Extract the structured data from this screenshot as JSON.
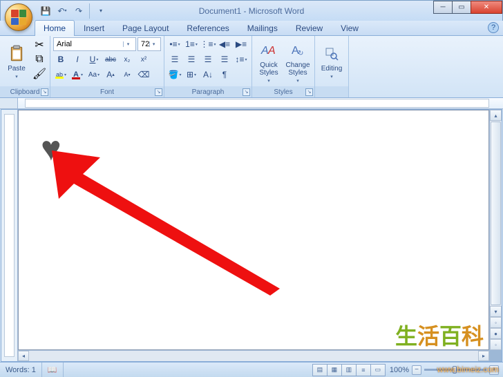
{
  "title": "Document1 - Microsoft Word",
  "tabs": [
    "Home",
    "Insert",
    "Page Layout",
    "References",
    "Mailings",
    "Review",
    "View"
  ],
  "active_tab": "Home",
  "clipboard": {
    "paste": "Paste",
    "label": "Clipboard"
  },
  "font": {
    "name": "Arial",
    "size": "72",
    "label": "Font",
    "bold": "B",
    "italic": "I",
    "underline": "U",
    "strike": "abc",
    "sub": "x₂",
    "sup": "x²",
    "highlight": "ab",
    "color": "A",
    "case": "Aa",
    "grow": "A",
    "shrink": "A",
    "clear": "A"
  },
  "paragraph": {
    "label": "Paragraph"
  },
  "styles": {
    "quick": "Quick Styles",
    "change": "Change Styles",
    "label": "Styles"
  },
  "editing": {
    "label": "Editing"
  },
  "status": {
    "words_label": "Words:",
    "words_count": "1",
    "zoom": "100%"
  },
  "watermark": {
    "cn": "生活百科",
    "url": "www.bimeiz.com"
  }
}
